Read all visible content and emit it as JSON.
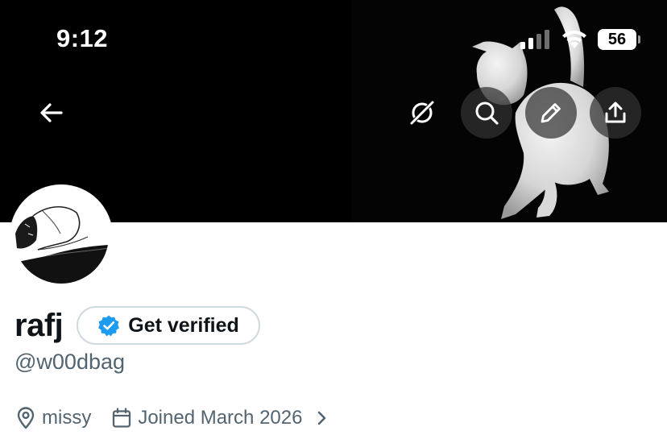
{
  "status_bar": {
    "time": "9:12",
    "battery_level": "56",
    "icons": [
      "cellular-signal-icon",
      "wifi-icon",
      "battery-icon"
    ]
  },
  "header": {
    "buttons": [
      "back-arrow-icon",
      "grok-icon",
      "search-icon",
      "edit-pencil-icon",
      "share-icon"
    ],
    "banner_image": "white kitten on black background"
  },
  "profile": {
    "display_name": "rafj",
    "verify_label": "Get verified",
    "handle": "@w00dbag",
    "location": "missy",
    "joined": "Joined March 2026"
  },
  "colors": {
    "text_primary": "#0f1419",
    "text_secondary": "#536471",
    "verified_blue": "#1d9bf0",
    "border": "#cfd9de"
  }
}
